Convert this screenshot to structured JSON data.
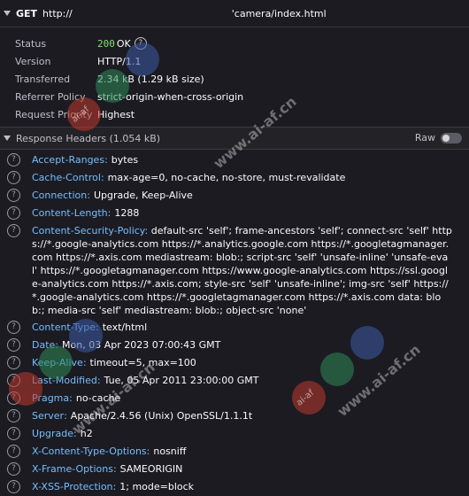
{
  "request": {
    "method": "GET",
    "url_prefix": "http://",
    "url_path": "'camera/index.html"
  },
  "summary": {
    "status_label": "Status",
    "status_code": "200",
    "status_text": "OK",
    "version_label": "Version",
    "version_value": "HTTP/1.1",
    "transferred_label": "Transferred",
    "transferred_value": "2.34 kB (1.29 kB size)",
    "referrer_label": "Referrer Policy",
    "referrer_value": "strict-origin-when-cross-origin",
    "priority_label": "Request Priority",
    "priority_value": "Highest"
  },
  "section": {
    "title": "Response Headers (1.054 kB)",
    "raw_label": "Raw"
  },
  "headers": [
    {
      "name": "Accept-Ranges",
      "value": "bytes"
    },
    {
      "name": "Cache-Control",
      "value": "max-age=0, no-cache, no-store, must-revalidate"
    },
    {
      "name": "Connection",
      "value": "Upgrade, Keep-Alive"
    },
    {
      "name": "Content-Length",
      "value": "1288"
    },
    {
      "name": "Content-Security-Policy",
      "value": "default-src 'self'; frame-ancestors 'self'; connect-src 'self' https://*.google-analytics.com https://*.analytics.google.com https://*.googletagmanager.com https://*.axis.com mediastream: blob:; script-src 'self' 'unsafe-inline' 'unsafe-eval' https://*.googletagmanager.com https://www.google-analytics.com https://ssl.google-analytics.com https://*.axis.com; style-src 'self' 'unsafe-inline'; img-src 'self' https://*.google-analytics.com https://*.googletagmanager.com https://*.axis.com data: blob:; media-src 'self' mediastream: blob:; object-src 'none'"
    },
    {
      "name": "Content-Type",
      "value": "text/html"
    },
    {
      "name": "Date",
      "value": "Mon, 03 Apr 2023 07:00:43 GMT"
    },
    {
      "name": "Keep-Alive",
      "value": "timeout=5, max=100"
    },
    {
      "name": "Last-Modified",
      "value": "Tue, 05 Apr 2011 23:00:00 GMT"
    },
    {
      "name": "Pragma",
      "value": "no-cache"
    },
    {
      "name": "Server",
      "value": "Apache/2.4.56 (Unix) OpenSSL/1.1.1t"
    },
    {
      "name": "Upgrade",
      "value": "h2"
    },
    {
      "name": "X-Content-Type-Options",
      "value": "nosniff"
    },
    {
      "name": "X-Frame-Options",
      "value": "SAMEORIGIN"
    },
    {
      "name": "X-XSS-Protection",
      "value": "1; mode=block"
    }
  ],
  "watermark": {
    "text": "www.ai-af.cn",
    "badge": "ai-af"
  },
  "colors": {
    "background": "#1c1b22",
    "header_name": "#75bfff",
    "status_ok": "#86de74",
    "label": "#bfbfc9"
  }
}
